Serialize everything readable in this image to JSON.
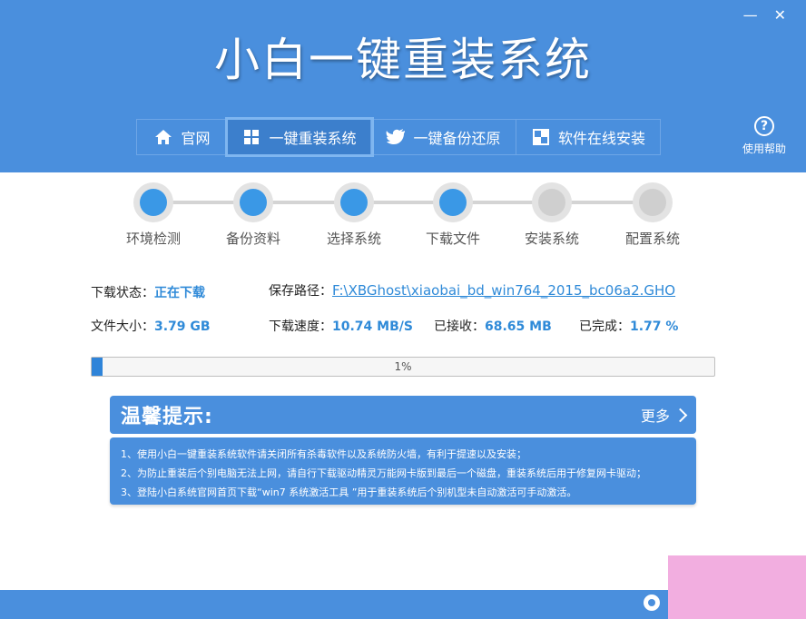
{
  "app": {
    "title": "小白一键重装系统"
  },
  "window_controls": {
    "minimize": "—",
    "close": "✕"
  },
  "nav": {
    "items": [
      {
        "label": "官网",
        "icon": "home-icon"
      },
      {
        "label": "一键重装系统",
        "icon": "windows-icon"
      },
      {
        "label": "一键备份还原",
        "icon": "bird-icon"
      },
      {
        "label": "软件在线安装",
        "icon": "software-icon"
      }
    ],
    "active_index": 1
  },
  "help": {
    "label": "使用帮助",
    "symbol": "?"
  },
  "steps": [
    {
      "label": "环境检测",
      "status": "done"
    },
    {
      "label": "备份资料",
      "status": "done"
    },
    {
      "label": "选择系统",
      "status": "done"
    },
    {
      "label": "下载文件",
      "status": "done"
    },
    {
      "label": "安装系统",
      "status": "pending"
    },
    {
      "label": "配置系统",
      "status": "pending"
    }
  ],
  "download": {
    "status_label": "下载状态：",
    "status_value": "正在下载",
    "path_label": "保存路径：",
    "path_value": "F:\\XBGhost\\xiaobai_bd_win764_2015_bc06a2.GHO",
    "size_label": "文件大小：",
    "size_value": "3.79 GB",
    "speed_label": "下载速度：",
    "speed_value": "10.74 MB/S",
    "received_label": "已接收：",
    "received_value": "68.65 MB",
    "complete_label": "已完成：",
    "complete_value": "1.77 %"
  },
  "progress": {
    "text": "1%",
    "fraction": 0.0177
  },
  "tips": {
    "title": "温馨提示:",
    "more_label": "更多",
    "lines": [
      "1、使用小白一键重装系统软件请关闭所有杀毒软件以及系统防火墙，有利于提速以及安装；",
      "2、为防止重装后个别电脑无法上网，请自行下载驱动精灵万能网卡版到最后一个磁盘，重装系统后用于修复网卡驱动；",
      "3、登陆小白系统官网首页下载“win7 系统激活工具 ”用于重装系统后个别机型未自动激活可手动激活。"
    ]
  },
  "colors": {
    "brand": "#4a8fdd",
    "accent": "#2f8ad8",
    "step_done": "#3a98e6",
    "step_pending": "#cfcfcf"
  }
}
